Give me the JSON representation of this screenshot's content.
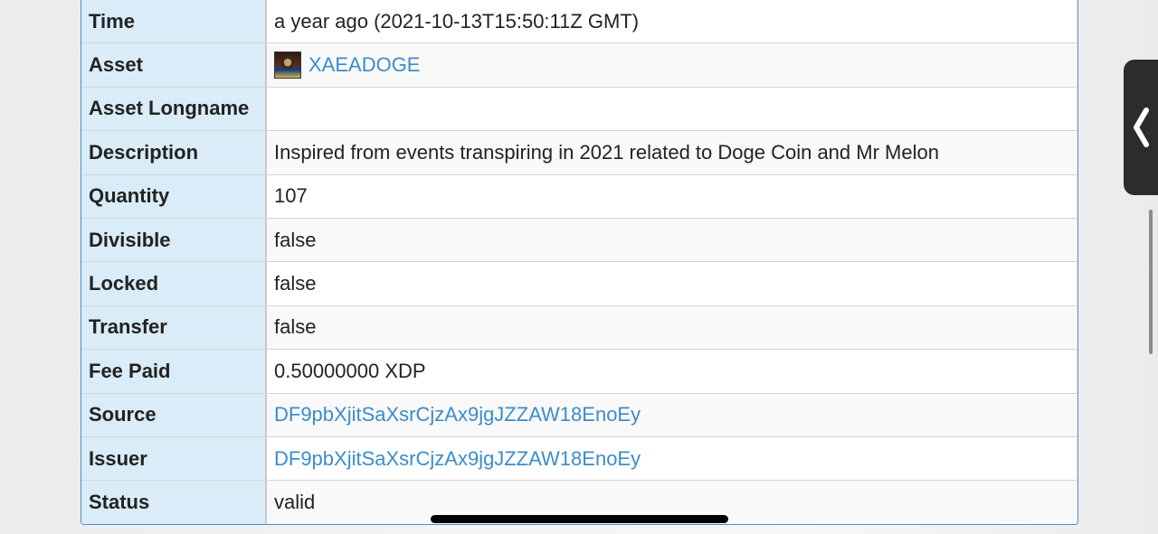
{
  "rows": [
    {
      "label": "Time",
      "value": "a year ago (2021-10-13T15:50:11Z GMT)"
    },
    {
      "label": "Asset",
      "value": "XAEADOGE"
    },
    {
      "label": "Asset Longname",
      "value": ""
    },
    {
      "label": "Description",
      "value": "Inspired from events transpiring in 2021 related to Doge Coin and Mr Melon"
    },
    {
      "label": "Quantity",
      "value": "107"
    },
    {
      "label": "Divisible",
      "value": "false"
    },
    {
      "label": "Locked",
      "value": "false"
    },
    {
      "label": "Transfer",
      "value": "false"
    },
    {
      "label": "Fee Paid",
      "value": "0.50000000 XDP"
    },
    {
      "label": "Source",
      "value": "DF9pbXjitSaXsrCjzAx9jgJZZAW18EnoEy"
    },
    {
      "label": "Issuer",
      "value": "DF9pbXjitSaXsrCjzAx9jgJZZAW18EnoEy"
    },
    {
      "label": "Status",
      "value": "valid"
    }
  ],
  "colors": {
    "label_bg": "#d9ecf7",
    "link": "#3c8ccb",
    "border": "#4a8fce"
  },
  "icons": {
    "asset_thumbnail": "asset-image-icon",
    "side_handle": "chevron-left-icon"
  }
}
